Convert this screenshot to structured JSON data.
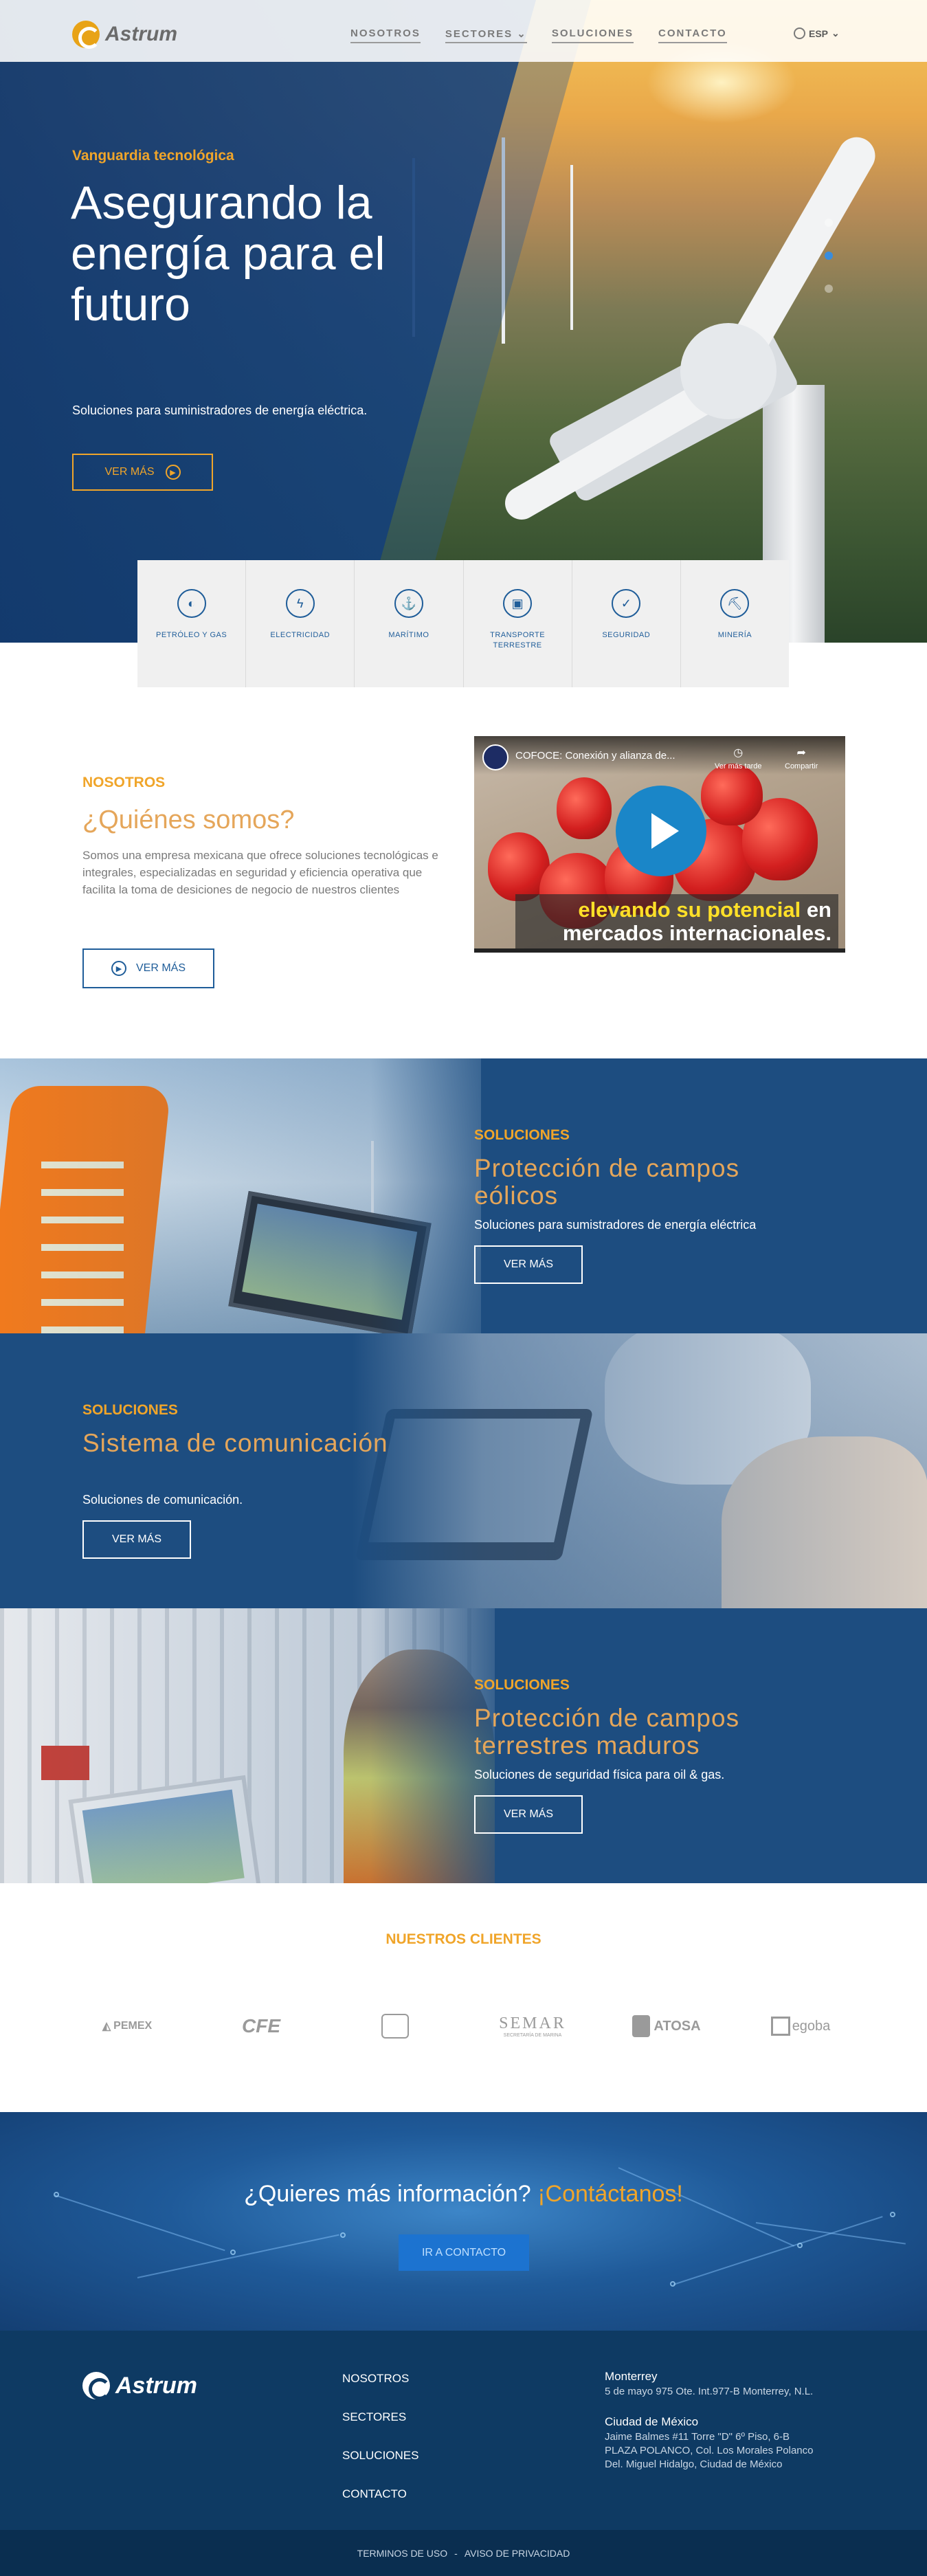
{
  "nav": {
    "brand": "Astrum",
    "links": [
      "NOSOTROS",
      "SECTORES",
      "SOLUCIONES",
      "CONTACTO"
    ],
    "language": "ESP"
  },
  "hero": {
    "eyebrow": "Vanguardia tecnológica",
    "title": "Asegurando la energía para el futuro",
    "subtitle": "Soluciones para suministradores de energía eléctrica.",
    "button": "VER MÁS"
  },
  "sectors": [
    {
      "label": "PETRÓLEO Y GAS",
      "icon": "oil-drop-icon"
    },
    {
      "label": "ELECTRICIDAD",
      "icon": "lightning-icon"
    },
    {
      "label": "MARÍTIMO",
      "icon": "anchor-icon"
    },
    {
      "label": "TRANSPORTE TERRESTRE",
      "icon": "bus-icon"
    },
    {
      "label": "SEGURIDAD",
      "icon": "shield-icon"
    },
    {
      "label": "MINERÍA",
      "icon": "mining-cart-icon"
    }
  ],
  "about": {
    "eyebrow": "NOSOTROS",
    "title": "¿Quiénes somos?",
    "text": "Somos una empresa mexicana que ofrece soluciones tecnológicas e integrales, especializadas en seguridad y eficiencia operativa que facilita la toma de desiciones de negocio de nuestros clientes",
    "button": "VER MÁS"
  },
  "video": {
    "title": "COFOCE: Conexión y alianza de...",
    "watch_later": "Ver más tarde",
    "share": "Compartir",
    "caption_highlight": "elevando su potencial",
    "caption_rest_1": " en",
    "caption_line2": "mercados internacionales."
  },
  "solutions": [
    {
      "eyebrow": "SOLUCIONES",
      "title": "Protección de campos eólicos",
      "subtitle": "Soluciones para sumistradores de energía eléctrica",
      "button": "VER MÁS"
    },
    {
      "eyebrow": "SOLUCIONES",
      "title": "Sistema de comunicación",
      "subtitle": "Soluciones de comunicación.",
      "button": "VER MÁS"
    },
    {
      "eyebrow": "SOLUCIONES",
      "title": "Protección de campos terrestres maduros",
      "subtitle": "Soluciones de seguridad física para oil & gas.",
      "button": "VER MÁS"
    }
  ],
  "clients": {
    "title": "NUESTROS CLIENTES",
    "logos": [
      "PEMEX",
      "CFE",
      "",
      "SEMAR",
      "ATOSA",
      "egoba"
    ],
    "semar_tagline": "SECRETARÍA DE MARINA"
  },
  "cta": {
    "question": "¿Quieres más información?",
    "accent": "¡Contáctanos!",
    "button": "IR A CONTACTO"
  },
  "footer": {
    "brand": "Astrum",
    "links": [
      "NOSOTROS",
      "SECTORES",
      "SOLUCIONES",
      "CONTACTO"
    ],
    "offices": [
      {
        "city": "Monterrey",
        "address": [
          "5 de mayo 975 Ote. Int.977-B Monterrey, N.L."
        ]
      },
      {
        "city": "Ciudad de México",
        "address": [
          "Jaime Balmes #11 Torre \"D\" 6º Piso, 6-B",
          "PLAZA POLANCO, Col. Los Morales Polanco",
          "Del. Miguel Hidalgo, Ciudad de México"
        ]
      }
    ],
    "terms": "TERMINOS DE USO",
    "separator": "-",
    "privacy": "AVISO DE PRIVACIDAD"
  },
  "colors": {
    "accent": "#f0a52a",
    "primary_blue": "#1f5d99",
    "band_blue": "#1d4d80",
    "footer_blue": "#0e3a63"
  }
}
